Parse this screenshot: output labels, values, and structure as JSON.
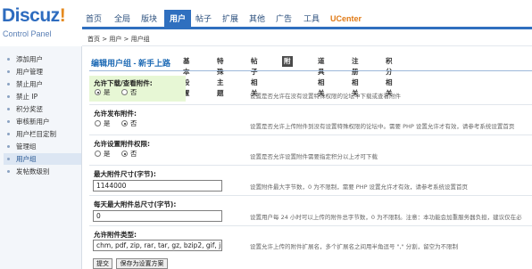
{
  "logo": {
    "brand": "Discuz",
    "bang": "!",
    "sub": "Control Panel"
  },
  "topnav": [
    "首页",
    "全局",
    "版块",
    "用户",
    "帖子",
    "扩展",
    "其他",
    "广告",
    "工具",
    "UCenter"
  ],
  "sidebar": [
    "添加用户",
    "用户管理",
    "禁止用户",
    "禁止 IP",
    "积分奖惩",
    "审核新用户",
    "用户栏目定制",
    "管理组",
    "用户组",
    "发帖数级别"
  ],
  "breadcrumb": "首页 > 用户 > 用户组",
  "page_title": "编辑用户组 - 新手上路",
  "subtabs": [
    "基本设置",
    "特殊主题",
    "帖子相关",
    "附件相关",
    "道具相关",
    "注册相关",
    "积分相关"
  ],
  "rows": [
    {
      "label": "允许下载/查看附件:",
      "yes": "是",
      "no": "否",
      "desc": "设置是否允许在没有设置特殊权限的论坛中下载或查看附件"
    },
    {
      "label": "允许发布附件:",
      "yes": "是",
      "no": "否",
      "desc": "设置是否允许上传附件到没有设置特殊权限的论坛中。需要 PHP 设置允许才有效，请参考系统设置首页"
    },
    {
      "label": "允许设置附件权限:",
      "yes": "是",
      "no": "否",
      "desc": "设置是否允许设置附件需要指定积分以上才可下载"
    },
    {
      "label": "最大附件尺寸(字节):",
      "value": "1144000",
      "desc": "设置附件最大字节数，0 为不限制，需要 PHP 设置允许才有效，请参考系统设置首页"
    },
    {
      "label": "每天最大附件总尺寸(字节):",
      "value": "0",
      "desc": "设置用户每 24 小时可以上传的附件总字节数，0 为不限制。注意：本功能会加重服务器负担，建议仅在必"
    },
    {
      "label": "允许附件类型:",
      "value": "chm, pdf, zip, rar, tar, gz, bzip2, gif, jpg,",
      "desc": "设置允许上传的附件扩展名，多个扩展名之间用半角逗号 \",\" 分割，留空为不限制"
    }
  ],
  "buttons": {
    "submit": "提交",
    "save_scheme": "保存为设置方案"
  },
  "colors": {
    "accent": "#2f6fbf",
    "highlight": "#e7f7d5",
    "ucenter": "#e07a16"
  }
}
